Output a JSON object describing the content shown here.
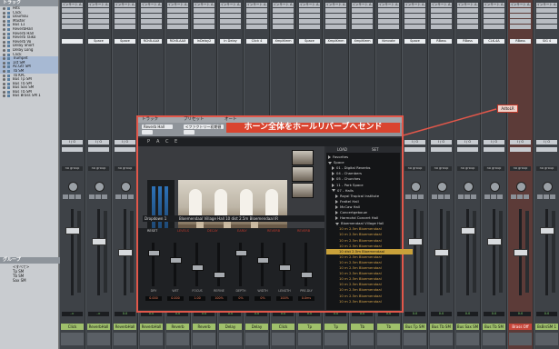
{
  "left_panel": {
    "tracks_header": "トラック",
    "tracks": [
      "Hits",
      "Click",
      "Doumou",
      "Master",
      "Bus L1",
      "ReverbHall",
      "Reverb Hall",
      "Reverb Taiko",
      "Reverb Vo",
      "Delay Short",
      "Delay Long",
      "Click",
      "Trumpet",
      "1st SM",
      "Ac.Gtr SM",
      "Tb SM",
      "Tb KPL",
      "Bus Tp SM",
      "Bus Tb SM",
      "Bus Sax SM",
      "Bus Tb SM",
      "Bus Brass SM 1"
    ],
    "groups_header": "グループ",
    "groups": [
      "<すべて>",
      "Tp SM",
      "Tb SM",
      "Sax SM"
    ]
  },
  "mixer": {
    "strips": [
      {
        "insert": "インサート A-E",
        "send": "",
        "io": "I / O",
        "group": "no group",
        "volume": "-∞",
        "name": "Click"
      },
      {
        "insert": "インサート A-E",
        "send": "Space",
        "io": "I / O",
        "group": "no group",
        "volume": "-∞",
        "name": "ReverbHall"
      },
      {
        "insert": "インサート A-E",
        "send": "Space",
        "io": "I / O",
        "group": "no group",
        "volume": "0.0",
        "name": "ReverbHall"
      },
      {
        "insert": "インサート A-E",
        "send": "RChB-AAX",
        "io": "I / O",
        "group": "no group",
        "volume": "0.0",
        "name": "ReverbHall"
      },
      {
        "insert": "インサート A-E",
        "send": "RChB-AAX",
        "io": "I / O",
        "group": "no group",
        "volume": "0.0",
        "name": "Reverb"
      },
      {
        "insert": "インサート A-E",
        "send": "InDelay2",
        "io": "I / O",
        "group": "no group",
        "volume": "0.0",
        "name": "Reverb"
      },
      {
        "insert": "インサート A-E",
        "send": "In Delay",
        "io": "I / O",
        "group": "no group",
        "volume": "0.0",
        "name": "Delay"
      },
      {
        "insert": "インサート A-E",
        "send": "Click 4",
        "io": "I / O",
        "group": "no group",
        "volume": "0.0",
        "name": "Delay"
      },
      {
        "insert": "インサート A-E",
        "send": "XmplKmm",
        "io": "I / O",
        "group": "no group",
        "volume": "0.0",
        "name": "Click"
      },
      {
        "insert": "インサート A-E",
        "send": "Space",
        "io": "I / O",
        "group": "no group",
        "volume": "0.0",
        "name": "Tp"
      },
      {
        "insert": "インサート A-E",
        "send": "XmplKmm",
        "io": "I / O",
        "group": "no group",
        "volume": "0.0",
        "name": "Tp"
      },
      {
        "insert": "インサート A-E",
        "send": "XmplKmm",
        "io": "I / O",
        "group": "no group",
        "volume": "0.0",
        "name": "Tb"
      },
      {
        "insert": "インサート A-E",
        "send": "Kenvate",
        "io": "I / O",
        "group": "no group",
        "volume": "0.0",
        "name": "Tb"
      },
      {
        "insert": "インサート A-E",
        "send": "Space",
        "io": "I / O",
        "group": "no group",
        "volume": "0.0",
        "name": "Bus Tp SM"
      },
      {
        "insert": "インサート A-E",
        "send": "RBass",
        "io": "I / O",
        "group": "no group",
        "volume": "0.0",
        "name": "Bus Tb SM"
      },
      {
        "insert": "インサート A-E",
        "send": "RBass",
        "io": "I / O",
        "group": "no group",
        "volume": "0.0",
        "name": "Bus Sax SM"
      },
      {
        "insert": "インサート A-E",
        "send": "CLK-4A",
        "io": "I / O",
        "group": "no group",
        "volume": "0.0",
        "name": "Bus Tb SM"
      },
      {
        "insert": "インサート A-E",
        "send": "RBass",
        "io": "I / O",
        "group": "no group",
        "volume": "0.0",
        "name": "Brass Off"
      },
      {
        "insert": "インサート A-E",
        "send": "SIG 4",
        "io": "I / O",
        "group": "no group",
        "volume": "0.0",
        "name": "BsBrsSM 1"
      }
    ],
    "highlight_badge": "AdtoLR"
  },
  "plugin": {
    "title_track": "トラック",
    "title_preset": "プリセット",
    "title_auto": "オート",
    "track_select": "Reverb Hall",
    "preset_default": "<ファクトリー初期値>",
    "callout": "ホーン全体をホールリバーブへセンド",
    "tabs": [
      "P",
      "A",
      "C",
      "E"
    ],
    "ir_name": "Dropdown 1",
    "ir_file": "Bloemendaal Village Hall 10 dist 2.5m Bloemendaal IR",
    "ctrl_header": [
      "RESET",
      "LEVELS",
      "DECAY",
      "EARLY",
      "REVERB",
      "REVERB"
    ],
    "ctrl_labels": [
      "DRY",
      "WET",
      "FOCUS",
      "REFINE",
      "DEPTH",
      "WIDTH",
      "LENGTH",
      "PRE-DLY"
    ],
    "ctrl_values": [
      "0.000",
      "0.000",
      "1.00",
      "100%",
      "0%",
      "0%",
      "100%",
      "0.0ms"
    ],
    "browser_tabs": [
      "LOAD",
      "SET"
    ],
    "browser_items": [
      {
        "t": "Favorites",
        "k": "root"
      },
      {
        "t": "Space",
        "k": "root"
      },
      {
        "t": "01 - Digital Reverbs",
        "k": "node"
      },
      {
        "t": "04 - Chambers",
        "k": "node"
      },
      {
        "t": "05 - Churches",
        "k": "node"
      },
      {
        "t": "11 - Park Space",
        "k": "node"
      },
      {
        "t": "07 - Halls",
        "k": "open"
      },
      {
        "t": "Royal Tropical Institute",
        "k": "node2"
      },
      {
        "t": "Frattel Hall",
        "k": "node2"
      },
      {
        "t": "McCaw Hall",
        "k": "node2"
      },
      {
        "t": "Concertgebouw",
        "k": "node2"
      },
      {
        "t": "Harmohd Concert Hall",
        "k": "node2"
      },
      {
        "t": "Bloemendaal Village Hall",
        "k": "open2"
      },
      {
        "t": "10 m 2.5m Bloemendaal",
        "k": "sub"
      },
      {
        "t": "10 m 2.5m Bloemendaal",
        "k": "sub"
      },
      {
        "t": "10 m 2.5m Bloemendaal",
        "k": "sub"
      },
      {
        "t": "10 m 2.5m Bloemendaal",
        "k": "sub"
      },
      {
        "t": "10 dist 2.5m Bloemendaal",
        "k": "sel"
      },
      {
        "t": "10 m 2.5m Bloemendaal",
        "k": "sub"
      },
      {
        "t": "10 m 2.5m Bloemendaal",
        "k": "sub"
      },
      {
        "t": "10 m 2.5m Bloemendaal",
        "k": "sub"
      },
      {
        "t": "10 m 2.5m Bloemendaal",
        "k": "sub"
      },
      {
        "t": "10 m 2.5m Bloemendaal",
        "k": "sub"
      },
      {
        "t": "10 m 2.5m Bloemendaal",
        "k": "sub"
      },
      {
        "t": "10 m 2.5m Bloemendaal",
        "k": "sub"
      },
      {
        "t": "10 m 2.5m Bloemendaal",
        "k": "sub"
      },
      {
        "t": "10 m 2.5m Bloemendaal",
        "k": "sub"
      }
    ]
  },
  "colors": {
    "highlight": "#e2574a",
    "selected": "#c9a13a",
    "strip_name": "#9fc06b"
  }
}
